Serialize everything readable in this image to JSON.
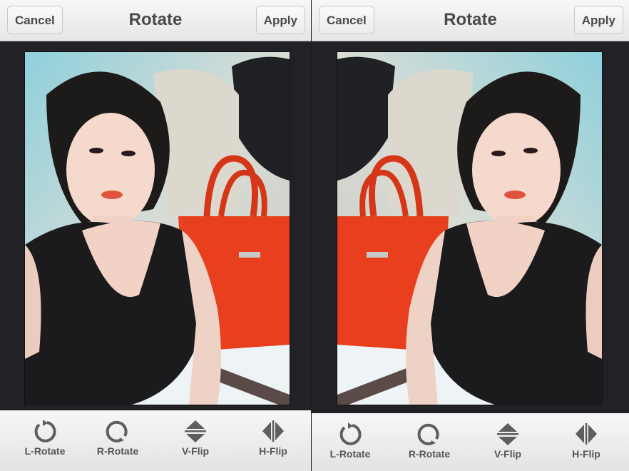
{
  "screens": [
    {
      "id": "left",
      "header": {
        "title": "Rotate",
        "cancel_label": "Cancel",
        "apply_label": "Apply"
      },
      "photo": {
        "description": "Woman in black top with red handbag",
        "orientation": "original"
      },
      "toolbar": [
        {
          "label": "L-Rotate",
          "icon": "rotate-left-icon"
        },
        {
          "label": "R-Rotate",
          "icon": "rotate-right-icon"
        },
        {
          "label": "V-Flip",
          "icon": "flip-vertical-icon"
        },
        {
          "label": "H-Flip",
          "icon": "flip-horizontal-icon"
        }
      ]
    },
    {
      "id": "right",
      "header": {
        "title": "Rotate",
        "cancel_label": "Cancel",
        "apply_label": "Apply"
      },
      "photo": {
        "description": "Woman in black top with red handbag",
        "orientation": "horizontally flipped"
      },
      "toolbar": [
        {
          "label": "L-Rotate",
          "icon": "rotate-left-icon"
        },
        {
          "label": "R-Rotate",
          "icon": "rotate-right-icon"
        },
        {
          "label": "V-Flip",
          "icon": "flip-vertical-icon"
        },
        {
          "label": "H-Flip",
          "icon": "flip-horizontal-icon"
        }
      ]
    }
  ],
  "colors": {
    "toolbar_text": "#555555",
    "header_text": "#4a4a4a",
    "canvas_bg": "#222226",
    "bag_red": "#e8401f",
    "top_black": "#1b1b1e"
  }
}
